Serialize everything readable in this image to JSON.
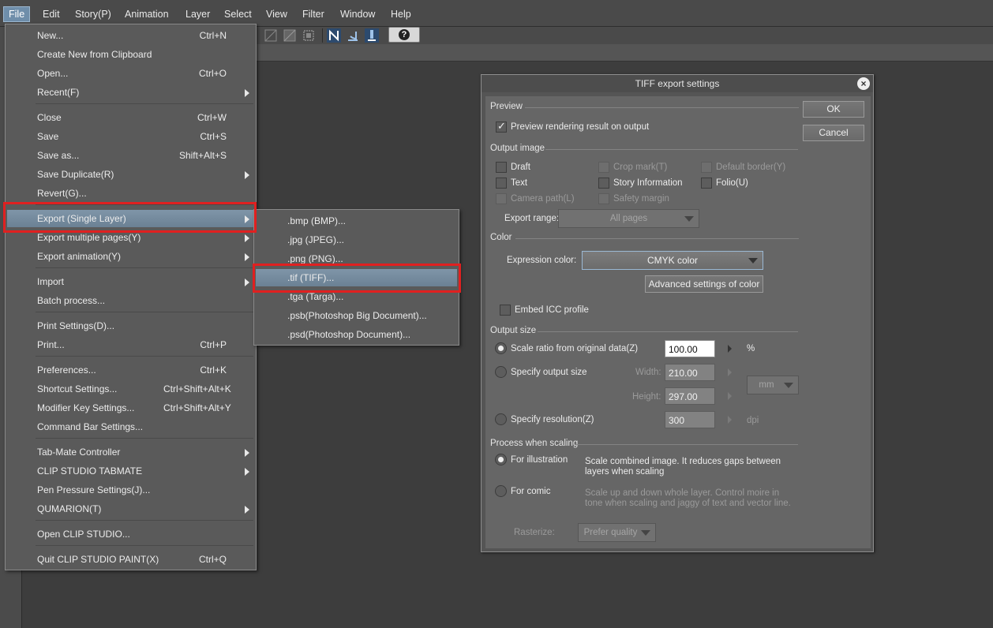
{
  "menubar": {
    "items": [
      "File",
      "Edit",
      "Story(P)",
      "Animation",
      "Layer",
      "Select",
      "View",
      "Filter",
      "Window",
      "Help"
    ]
  },
  "file_menu": {
    "items": [
      {
        "label": "New...",
        "shortcut": "Ctrl+N"
      },
      {
        "label": "Create New from Clipboard",
        "shortcut": ""
      },
      {
        "label": "Open...",
        "shortcut": "Ctrl+O"
      },
      {
        "label": "Recent(F)",
        "shortcut": ""
      },
      {
        "label": "Close",
        "shortcut": "Ctrl+W"
      },
      {
        "label": "Save",
        "shortcut": "Ctrl+S"
      },
      {
        "label": "Save as...",
        "shortcut": "Shift+Alt+S"
      },
      {
        "label": "Save Duplicate(R)",
        "shortcut": ""
      },
      {
        "label": "Revert(G)...",
        "shortcut": ""
      },
      {
        "label": "Export (Single Layer)",
        "shortcut": ""
      },
      {
        "label": "Export multiple pages(Y)",
        "shortcut": ""
      },
      {
        "label": "Export animation(Y)",
        "shortcut": ""
      },
      {
        "label": "Import",
        "shortcut": ""
      },
      {
        "label": "Batch process...",
        "shortcut": ""
      },
      {
        "label": "Print Settings(D)...",
        "shortcut": ""
      },
      {
        "label": "Print...",
        "shortcut": "Ctrl+P"
      },
      {
        "label": "Preferences...",
        "shortcut": "Ctrl+K"
      },
      {
        "label": "Shortcut Settings...",
        "shortcut": "Ctrl+Shift+Alt+K"
      },
      {
        "label": "Modifier Key Settings...",
        "shortcut": "Ctrl+Shift+Alt+Y"
      },
      {
        "label": "Command Bar Settings...",
        "shortcut": ""
      },
      {
        "label": "Tab-Mate Controller",
        "shortcut": ""
      },
      {
        "label": "CLIP STUDIO TABMATE",
        "shortcut": ""
      },
      {
        "label": "Pen Pressure Settings(J)...",
        "shortcut": ""
      },
      {
        "label": "QUMARION(T)",
        "shortcut": ""
      },
      {
        "label": "Open CLIP STUDIO...",
        "shortcut": ""
      },
      {
        "label": "Quit CLIP STUDIO PAINT(X)",
        "shortcut": "Ctrl+Q"
      }
    ]
  },
  "export_submenu": {
    "items": [
      ".bmp (BMP)...",
      ".jpg (JPEG)...",
      ".png (PNG)...",
      ".tif (TIFF)...",
      ".tga (Targa)...",
      ".psb(Photoshop Big Document)...",
      ".psd(Photoshop Document)..."
    ]
  },
  "dialog": {
    "title": "TIFF export settings",
    "ok_label": "OK",
    "cancel_label": "Cancel",
    "preview": {
      "heading": "Preview",
      "render_label": "Preview rendering result on output",
      "render_checked": true
    },
    "output_image": {
      "heading": "Output image",
      "draft": "Draft",
      "text": "Text",
      "camera_path": "Camera path(L)",
      "crop_mark": "Crop mark(T)",
      "story_info": "Story Information",
      "safety_margin": "Safety margin",
      "default_border": "Default border(Y)",
      "folio": "Folio(U)",
      "export_range_label": "Export range:",
      "export_range_value": "All pages"
    },
    "color": {
      "heading": "Color",
      "expression_label": "Expression color:",
      "expression_value": "CMYK color",
      "advanced_button": "Advanced settings of color",
      "embed_icc": "Embed ICC profile"
    },
    "output_size": {
      "heading": "Output size",
      "scale_label": "Scale ratio from original data(Z)",
      "scale_value": "100.00",
      "scale_unit": "%",
      "specify_size_label": "Specify output size",
      "width_label": "Width:",
      "width_value": "210.00",
      "height_label": "Height:",
      "height_value": "297.00",
      "unit_value": "mm",
      "resolution_label": "Specify resolution(Z)",
      "resolution_value": "300",
      "resolution_unit": "dpi",
      "selected": "scale"
    },
    "process": {
      "heading": "Process when scaling",
      "illustration_label": "For illustration",
      "illustration_desc_1": "Scale combined image. It reduces gaps between",
      "illustration_desc_2": "layers when scaling",
      "comic_label": "For comic",
      "comic_desc_1": "Scale up and down whole layer. Control moire in",
      "comic_desc_2": "tone when scaling and jaggy of text and vector line.",
      "rasterize_label": "Rasterize:",
      "rasterize_value": "Prefer quality",
      "selected": "illustration"
    }
  },
  "colors": {
    "highlight_box": "#e02020",
    "menu_highlight": "#7f95a8"
  }
}
